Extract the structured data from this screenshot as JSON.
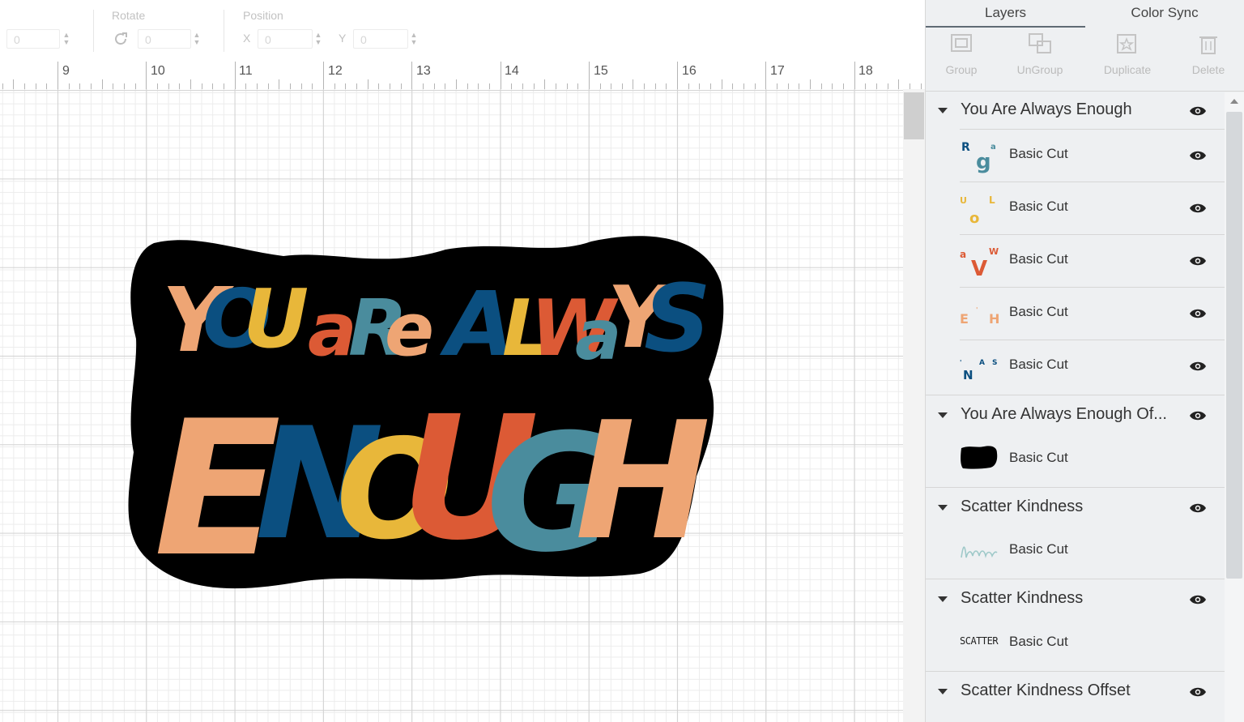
{
  "toolbar": {
    "size_value": "0",
    "rotate_label": "Rotate",
    "rotate_value": "0",
    "position_label": "Position",
    "x_label": "X",
    "x_value": "0",
    "y_label": "Y",
    "y_value": "0"
  },
  "ruler": {
    "numbers": [
      "9",
      "10",
      "11",
      "12",
      "13",
      "14",
      "15",
      "16",
      "17",
      "18"
    ]
  },
  "canvas": {
    "design_line1": [
      "Y",
      "O",
      "U",
      "a",
      "R",
      "e",
      "A",
      "L",
      "W",
      "a",
      "Y",
      "S"
    ],
    "design_line2": [
      "E",
      "N",
      "O",
      "U",
      "G",
      "H"
    ],
    "colors": {
      "peach": "#eea574",
      "navy": "#0b4f80",
      "mustard": "#e8b73a",
      "rust": "#dc5a35",
      "teal": "#4a8c9d",
      "sticker": "#000000"
    }
  },
  "panel": {
    "tabs": [
      {
        "label": "Layers",
        "active": true
      },
      {
        "label": "Color Sync",
        "active": false
      }
    ],
    "actions": [
      {
        "label": "Group",
        "icon": "group-icon"
      },
      {
        "label": "UnGroup",
        "icon": "ungroup-icon"
      },
      {
        "label": "Duplicate",
        "icon": "duplicate-icon"
      },
      {
        "label": "Delete",
        "icon": "trash-icon"
      }
    ],
    "groups": [
      {
        "title": "You Are Always Enough",
        "layers": [
          {
            "label": "Basic Cut",
            "thumb": "R g a"
          },
          {
            "label": "Basic Cut",
            "thumb": "U L o"
          },
          {
            "label": "Basic Cut",
            "thumb": "a W V"
          },
          {
            "label": "Basic Cut",
            "thumb": "E Y H"
          },
          {
            "label": "Basic Cut",
            "thumb": "N A S"
          }
        ]
      },
      {
        "title": "You Are Always Enough Of...",
        "layers": [
          {
            "label": "Basic Cut",
            "thumb": "black-shape"
          }
        ]
      },
      {
        "title": "Scatter Kindness",
        "layers": [
          {
            "label": "Basic Cut",
            "thumb": "kindness"
          }
        ]
      },
      {
        "title": "Scatter Kindness",
        "layers": [
          {
            "label": "Basic Cut",
            "thumb": "SCATTER"
          }
        ]
      },
      {
        "title": "Scatter Kindness Offset",
        "layers": []
      }
    ]
  }
}
